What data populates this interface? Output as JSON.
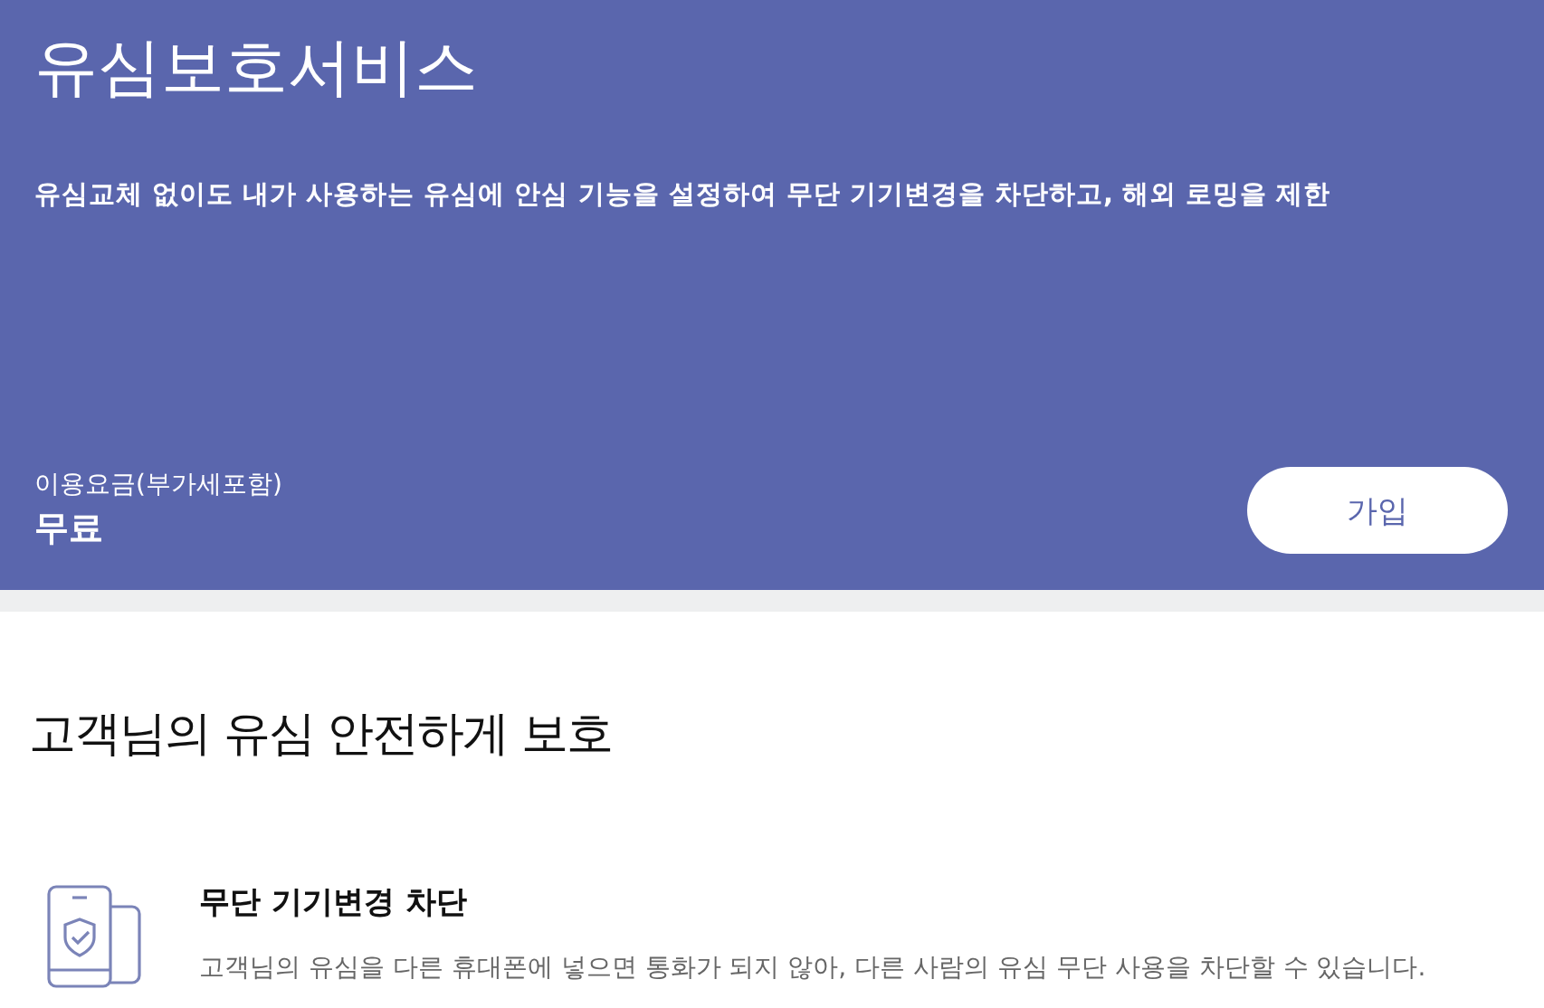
{
  "hero": {
    "title": "유심보호서비스",
    "description": "유심교체 없이도 내가 사용하는 유심에 안심 기능을 설정하여 무단 기기변경을 차단하고, 해외 로밍을 제한",
    "fee_label": "이용요금(부가세포함)",
    "fee_value": "무료",
    "join_button": "가입"
  },
  "section": {
    "heading": "고객님의 유심 안전하게 보호",
    "features": [
      {
        "title": "무단 기기변경 차단",
        "description": "고객님의 유심을 다른 휴대폰에 넣으면 통화가 되지 않아, 다른 사람의 유심 무단 사용을 차단할 수 있습니다."
      }
    ]
  }
}
